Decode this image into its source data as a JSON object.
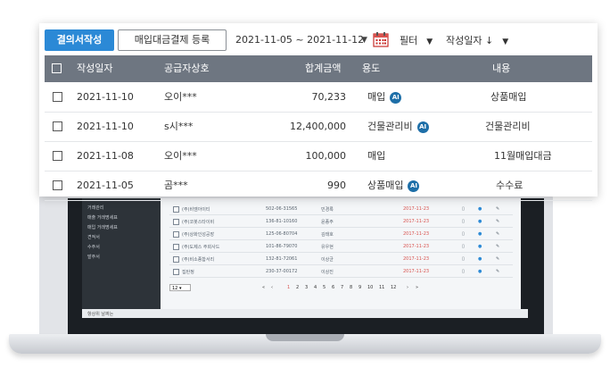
{
  "toolbar": {
    "primary_button": "결의서작성",
    "secondary_button": "매입대금결제 등록",
    "date_range": "2021-11-05 ~ 2021-11-12",
    "filter_label": "필터",
    "sort_label": "작성일자 ↓"
  },
  "table": {
    "headers": [
      "작성일자",
      "공급자상호",
      "합계금액",
      "용도",
      "내용"
    ],
    "rows": [
      {
        "date": "2021-11-10",
        "supplier": "오이***",
        "amount": "70,233",
        "usage": "매입",
        "ai": "AI",
        "content": "상품매입"
      },
      {
        "date": "2021-11-10",
        "supplier": "s시***",
        "amount": "12,400,000",
        "usage": "건물관리비",
        "ai": "AI",
        "content": "건물관리비"
      },
      {
        "date": "2021-11-08",
        "supplier": "오이***",
        "amount": "100,000",
        "usage": "매입",
        "ai": "",
        "content": "11월매입대금"
      },
      {
        "date": "2021-11-05",
        "supplier": "곰***",
        "amount": "990",
        "usage": "상품매입",
        "ai": "AI",
        "content": "수수료"
      }
    ]
  },
  "colors": {
    "primary": "#2b89d6",
    "header": "#6e7681",
    "ai_badge": "#1e6fa8"
  },
  "mini_app": {
    "sidebar": [
      "거래관리",
      "매출 거래명세표",
      "매입 거래명세표",
      "견적서",
      "수주서",
      "발주서"
    ],
    "rows": [
      {
        "name": "(주)비엠아이티",
        "num": "502-06-31565",
        "person": "민경록",
        "date": "2017-11-23"
      },
      {
        "name": "(주)코봇스타이비",
        "num": "136-81-10160",
        "person": "윤종주",
        "date": "2017-11-23"
      },
      {
        "name": "(주)상화인성공장",
        "num": "125-06-80704",
        "person": "김태호",
        "date": "2017-11-23"
      },
      {
        "name": "(주)도제스 주회사드",
        "num": "101-86-79070",
        "person": "유우현",
        "date": "2017-11-23"
      },
      {
        "name": "(주)비소종합서리",
        "num": "132-81-72061",
        "person": "이상균",
        "date": "2017-11-23"
      },
      {
        "name": "집탄정",
        "num": "230-37-00172",
        "person": "이상진",
        "date": "2017-11-23"
      }
    ],
    "rows_per_page": "12",
    "pages": [
      "1",
      "2",
      "3",
      "4",
      "5",
      "6",
      "7",
      "8",
      "9",
      "10",
      "11",
      "12"
    ],
    "footer": "항상위 날짜는"
  }
}
